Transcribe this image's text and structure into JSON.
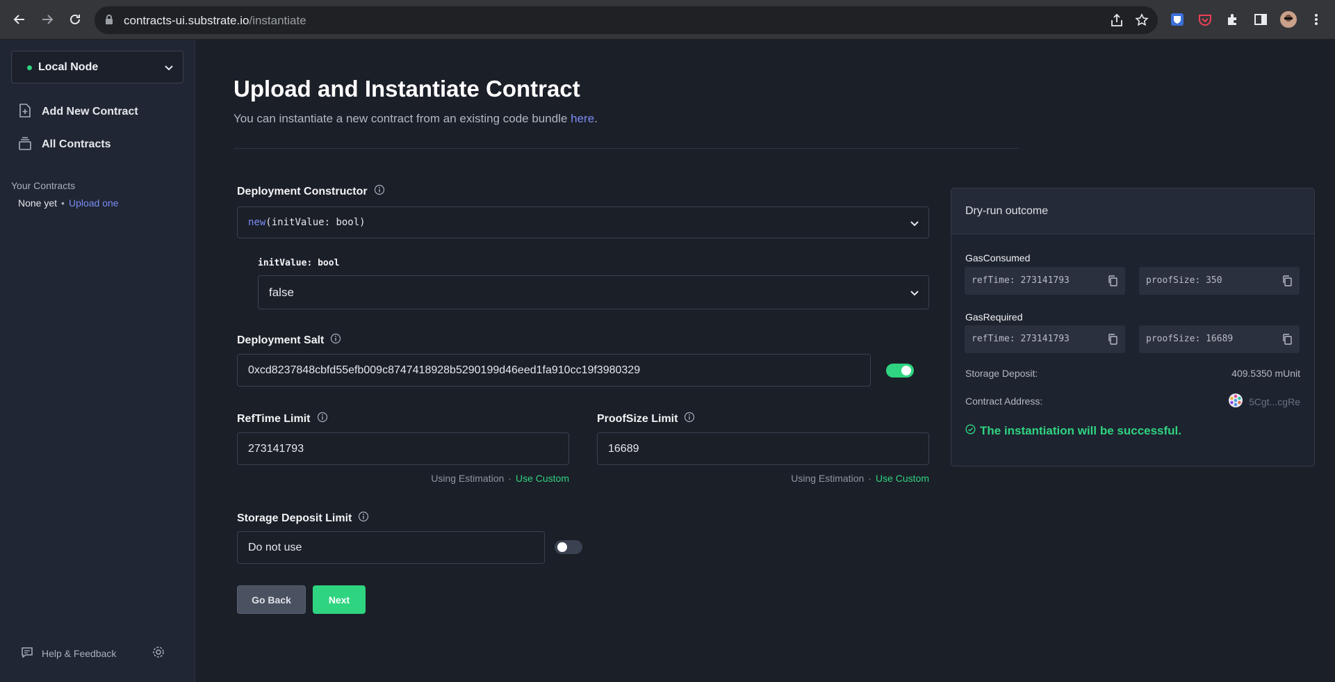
{
  "browser": {
    "url_host": "contracts-ui.substrate.io",
    "url_path": "/instantiate"
  },
  "sidebar": {
    "node": "Local Node",
    "items": [
      {
        "label": "Add New Contract",
        "icon": "file-plus-icon"
      },
      {
        "label": "All Contracts",
        "icon": "stack-icon"
      }
    ],
    "your_contracts": "Your Contracts",
    "none_yet": "None yet",
    "upload_one": "Upload one",
    "help": "Help & Feedback"
  },
  "main": {
    "title": "Upload and Instantiate Contract",
    "subtitle": "You can instantiate a new contract from an existing code bundle",
    "subtitle_link": "here",
    "constructor_label": "Deployment Constructor",
    "constructor_fn": "new",
    "constructor_args": "(initValue: bool)",
    "arg_label": "initValue: bool",
    "arg_value": "false",
    "salt_label": "Deployment Salt",
    "salt_value": "0xcd8237848cbfd55efb009c8747418928b5290199d46eed1fa910cc19f3980329",
    "salt_toggle_on": true,
    "reftime_label": "RefTime Limit",
    "reftime_placeholder": "273141793",
    "proofsize_label": "ProofSize Limit",
    "proofsize_placeholder": "16689",
    "using_estimation": "Using Estimation",
    "use_custom": "Use Custom",
    "storage_label": "Storage Deposit Limit",
    "storage_placeholder": "Do not use",
    "storage_toggle_on": false,
    "go_back": "Go Back",
    "next": "Next"
  },
  "dry_run": {
    "title": "Dry-run outcome",
    "gas_consumed_label": "GasConsumed",
    "gas_consumed_reftime": "refTime: 273141793",
    "gas_consumed_proofsize": "proofSize: 350",
    "gas_required_label": "GasRequired",
    "gas_required_reftime": "refTime: 273141793",
    "gas_required_proofsize": "proofSize: 16689",
    "storage_deposit_label": "Storage Deposit:",
    "storage_deposit_value": "409.5350 mUnit",
    "contract_address_label": "Contract Address:",
    "contract_address_value": "5Cgt...cgRe",
    "success": "The instantiation will be successful."
  },
  "colors": {
    "accent_green": "#2fd480",
    "link_blue": "#7b8cf6",
    "background": "#1b1f28"
  }
}
